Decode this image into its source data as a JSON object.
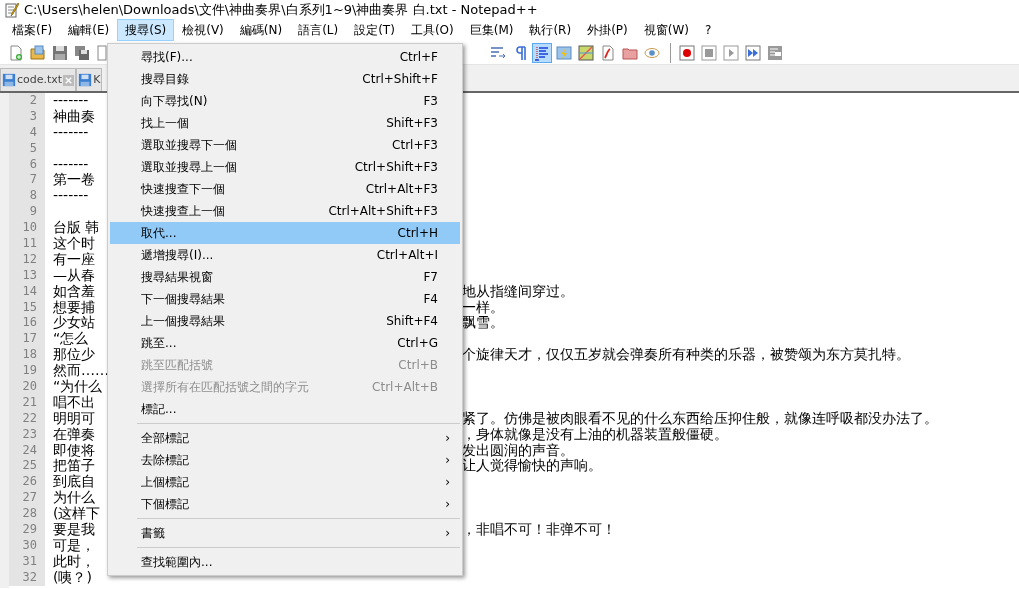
{
  "window": {
    "title": "C:\\Users\\helen\\Downloads\\文件\\神曲奏界\\白系列1~9\\神曲奏界 白.txt - Notepad++"
  },
  "menu_bar": [
    {
      "label": "檔案(F)",
      "selected": false
    },
    {
      "label": "編輯(E)",
      "selected": false
    },
    {
      "label": "搜尋(S)",
      "selected": true
    },
    {
      "label": "檢視(V)",
      "selected": false
    },
    {
      "label": "編碼(N)",
      "selected": false
    },
    {
      "label": "語言(L)",
      "selected": false
    },
    {
      "label": "設定(T)",
      "selected": false
    },
    {
      "label": "工具(O)",
      "selected": false
    },
    {
      "label": "巨集(M)",
      "selected": false
    },
    {
      "label": "執行(R)",
      "selected": false
    },
    {
      "label": "外掛(P)",
      "selected": false
    },
    {
      "label": "視窗(W)",
      "selected": false
    },
    {
      "label": "?",
      "selected": false
    }
  ],
  "toolbar_left": [
    {
      "kind": "new",
      "pressed": false
    },
    {
      "kind": "open",
      "pressed": false
    },
    {
      "kind": "save",
      "pressed": false
    },
    {
      "kind": "saveall",
      "pressed": false
    },
    {
      "kind": "page",
      "pressed": false
    }
  ],
  "toolbar_right": [
    {
      "kind": "wrap",
      "pressed": false
    },
    {
      "kind": "pilcrow",
      "pressed": false
    },
    {
      "kind": "indent",
      "pressed": true
    },
    {
      "kind": "lightning",
      "pressed": false
    },
    {
      "kind": "map",
      "pressed": false
    },
    {
      "kind": "doc",
      "pressed": false
    },
    {
      "kind": "folder",
      "pressed": false
    },
    {
      "kind": "eye",
      "pressed": false
    },
    {
      "kind": "sep"
    },
    {
      "kind": "record",
      "pressed": false
    },
    {
      "kind": "stop",
      "pressed": false
    },
    {
      "kind": "play",
      "pressed": false
    },
    {
      "kind": "ffwd",
      "pressed": false
    },
    {
      "kind": "macro",
      "pressed": false
    }
  ],
  "tabs": [
    {
      "label": "code.txt",
      "closable": true
    },
    {
      "label": "K",
      "closable": false
    }
  ],
  "editor": {
    "lines": [
      {
        "number": "2",
        "left": "-------"
      },
      {
        "number": "3",
        "left": "神曲奏"
      },
      {
        "number": "4",
        "left": "-------"
      },
      {
        "number": "5"
      },
      {
        "number": "6",
        "left": "-------"
      },
      {
        "number": "7",
        "left": "第一卷"
      },
      {
        "number": "8",
        "left": "-------"
      },
      {
        "number": "9"
      },
      {
        "number": "10",
        "left": "台版 韩"
      },
      {
        "number": "11",
        "left": "这个时"
      },
      {
        "number": "12",
        "left": "有一座"
      },
      {
        "number": "13",
        "left": "—从春"
      },
      {
        "number": "14",
        "left": "如含羞",
        "right": "地从指缝间穿过。"
      },
      {
        "number": "15",
        "left": "想要捕",
        "right": "一样。"
      },
      {
        "number": "16",
        "left": "少女站",
        "right": "飘雪。"
      },
      {
        "number": "17",
        "left": "“怎么"
      },
      {
        "number": "18",
        "left": "那位少",
        "right": "个旋律天才，仅仅五岁就会弹奏所有种类的乐器，被赞颂为东方莫扎特。"
      },
      {
        "number": "19",
        "left": "然而……"
      },
      {
        "number": "20",
        "left": "“为什么"
      },
      {
        "number": "21",
        "left": "唱不出"
      },
      {
        "number": "22",
        "left": "明明可",
        "right": "紧了。仿佛是被肉眼看不见的什么东西给压抑住般，就像连呼吸都没办法了。"
      },
      {
        "number": "23",
        "left": "在弹奏",
        "right": "，身体就像是没有上油的机器装置般僵硬。"
      },
      {
        "number": "24",
        "left": "即使将",
        "right": "发出圆润的声音。"
      },
      {
        "number": "25",
        "left": "把笛子",
        "right": "让人觉得愉快的声响。"
      },
      {
        "number": "26",
        "left": "到底自"
      },
      {
        "number": "27",
        "left": "为什么"
      },
      {
        "number": "28",
        "left": "(这样下"
      },
      {
        "number": "29",
        "left": "要是我",
        "right": "，非唱不可！非弹不可！"
      },
      {
        "number": "30",
        "left": "可是，"
      },
      {
        "number": "31",
        "left": "此时，"
      },
      {
        "number": "32",
        "left": "(咦？)"
      }
    ]
  },
  "dropdown_menu": [
    {
      "kind": "item",
      "label": "尋找(F)...",
      "shortcut": "Ctrl+F",
      "disabled": false,
      "selected": false
    },
    {
      "kind": "item",
      "label": "搜尋目錄",
      "shortcut": "Ctrl+Shift+F",
      "disabled": false,
      "selected": false
    },
    {
      "kind": "item",
      "label": "向下尋找(N)",
      "shortcut": "F3",
      "disabled": false,
      "selected": false
    },
    {
      "kind": "item",
      "label": "找上一個",
      "shortcut": "Shift+F3",
      "disabled": false,
      "selected": false
    },
    {
      "kind": "item",
      "label": "選取並搜尋下一個",
      "shortcut": "Ctrl+F3",
      "disabled": false,
      "selected": false
    },
    {
      "kind": "item",
      "label": "選取並搜尋上一個",
      "shortcut": "Ctrl+Shift+F3",
      "disabled": false,
      "selected": false
    },
    {
      "kind": "item",
      "label": "快速搜查下一個",
      "shortcut": "Ctrl+Alt+F3",
      "disabled": false,
      "selected": false
    },
    {
      "kind": "item",
      "label": "快速搜查上一個",
      "shortcut": "Ctrl+Alt+Shift+F3",
      "disabled": false,
      "selected": false
    },
    {
      "kind": "item",
      "label": "取代...",
      "shortcut": "Ctrl+H",
      "disabled": false,
      "selected": true
    },
    {
      "kind": "item",
      "label": "遞增搜尋(I)...",
      "shortcut": "Ctrl+Alt+I",
      "disabled": false,
      "selected": false
    },
    {
      "kind": "item",
      "label": "搜尋結果視窗",
      "shortcut": "F7",
      "disabled": false,
      "selected": false
    },
    {
      "kind": "item",
      "label": "下一個搜尋結果",
      "shortcut": "F4",
      "disabled": false,
      "selected": false
    },
    {
      "kind": "item",
      "label": "上一個搜尋結果",
      "shortcut": "Shift+F4",
      "disabled": false,
      "selected": false
    },
    {
      "kind": "item",
      "label": "跳至...",
      "shortcut": "Ctrl+G",
      "disabled": false,
      "selected": false
    },
    {
      "kind": "item",
      "label": "跳至匹配括號",
      "shortcut": "Ctrl+B",
      "disabled": true,
      "selected": false
    },
    {
      "kind": "item",
      "label": "選擇所有在匹配括號之間的字元",
      "shortcut": "Ctrl+Alt+B",
      "disabled": true,
      "selected": false
    },
    {
      "kind": "item",
      "label": "標記...",
      "disabled": false,
      "selected": false
    },
    {
      "kind": "separator"
    },
    {
      "kind": "submenu",
      "label": "全部標記",
      "arrow": "›",
      "disabled": false,
      "selected": false
    },
    {
      "kind": "submenu",
      "label": "去除標記",
      "arrow": "›",
      "disabled": false,
      "selected": false
    },
    {
      "kind": "submenu",
      "label": "上個標記",
      "arrow": "›",
      "disabled": false,
      "selected": false
    },
    {
      "kind": "submenu",
      "label": "下個標記",
      "arrow": "›",
      "disabled": false,
      "selected": false
    },
    {
      "kind": "separator"
    },
    {
      "kind": "submenu",
      "label": "書籤",
      "arrow": "›",
      "disabled": false,
      "selected": false
    },
    {
      "kind": "separator"
    },
    {
      "kind": "item",
      "label": "查找範圍內...",
      "disabled": false,
      "selected": false
    }
  ]
}
